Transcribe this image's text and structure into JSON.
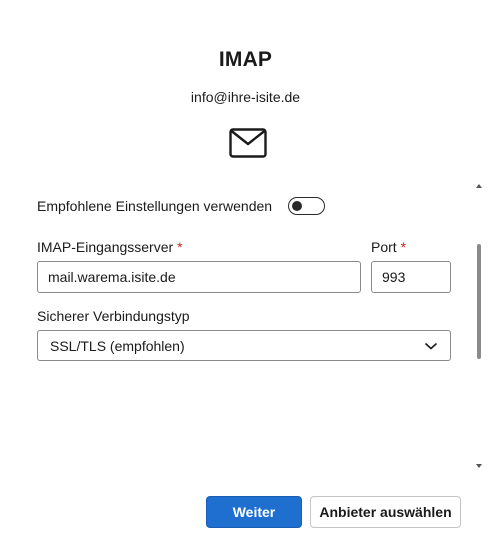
{
  "header": {
    "title": "IMAP",
    "email": "info@ihre-isite.de",
    "icon": "mail-icon"
  },
  "settings": {
    "recommended_label": "Empfohlene Einstellungen verwenden",
    "recommended_enabled": false
  },
  "server": {
    "label": "IMAP-Eingangsserver",
    "required_mark": "*",
    "value": "mail.warema.isite.de"
  },
  "port": {
    "label": "Port",
    "required_mark": "*",
    "value": "993"
  },
  "connection": {
    "label": "Sicherer Verbindungstyp",
    "selected": "SSL/TLS (empfohlen)"
  },
  "actions": {
    "next_label": "Weiter",
    "choose_provider_label": "Anbieter auswählen"
  },
  "colors": {
    "primary": "#1f6fd0",
    "required": "#c42b1c"
  }
}
